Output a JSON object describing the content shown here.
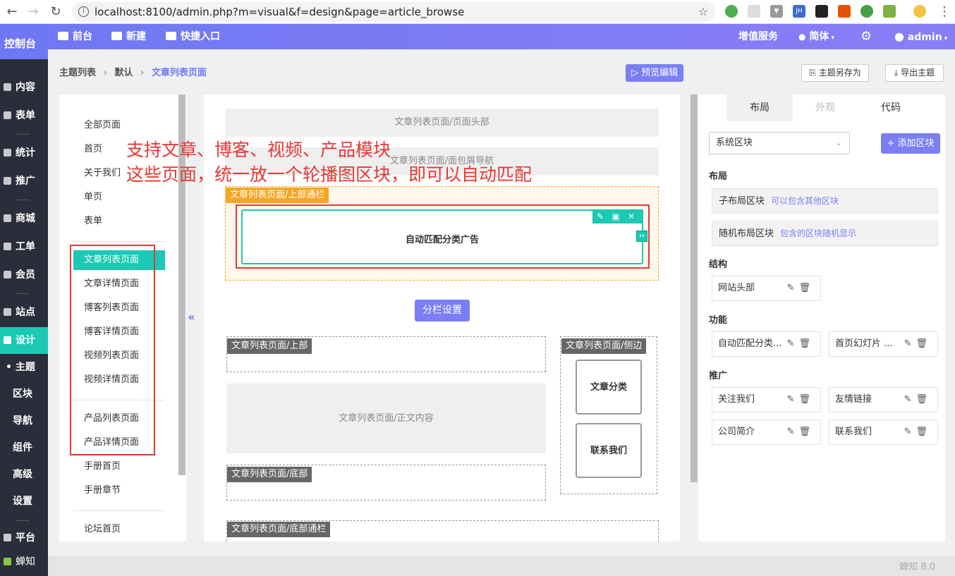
{
  "browser": {
    "url": "localhost:8100/admin.php?m=visual&f=design&page=article_browse",
    "back_icon": "arrow-left-icon",
    "extensions": [
      "globe",
      "ext",
      "vue",
      "JH",
      "cat",
      "share",
      "chrome",
      "rss",
      "avatar"
    ]
  },
  "topbar": {
    "brand": "控制台",
    "items": [
      "前台",
      "新建",
      "快捷入口"
    ],
    "right": {
      "value_added": "增值服务",
      "lang": "简体",
      "user": "admin"
    }
  },
  "sidebar": {
    "items": [
      {
        "label": "内容"
      },
      {
        "label": "表单"
      },
      {
        "label": "统计"
      },
      {
        "label": "推广"
      },
      {
        "label": "商城"
      },
      {
        "label": "工单"
      },
      {
        "label": "会员"
      },
      {
        "label": "站点"
      },
      {
        "label": "设计"
      }
    ],
    "sub": [
      "主题",
      "区块",
      "导航",
      "组件",
      "高级",
      "设置"
    ],
    "bottom": {
      "platform": "平台",
      "logo": "蝉知"
    }
  },
  "breadcrumb": {
    "a": "主题列表",
    "b": "默认",
    "current": "文章列表页面"
  },
  "toolbar": {
    "preview": "预览编辑",
    "save_as": "主题另存为",
    "export": "导出主题"
  },
  "pages": {
    "items": [
      "全部页面",
      "首页",
      "关于我们",
      "单页",
      "表单",
      "文章列表页面",
      "文章详情页面",
      "博客列表页面",
      "博客详情页面",
      "视频列表页面",
      "视频详情页面",
      "产品列表页面",
      "产品详情页面",
      "手册首页",
      "手册章节",
      "论坛首页"
    ]
  },
  "annotation": {
    "line1": "支持文章、博客、视频、产品模块",
    "line2": "这些页面，统一放一个轮播图区块，即可以自动匹配"
  },
  "canvas": {
    "header": "文章列表页面/页面头部",
    "nav": "文章列表页面/面包屑导航",
    "top_banner": "文章列表页面/上部通栏",
    "ad_block": "自动匹配分类广告",
    "column_settings": "分栏设置",
    "top": "文章列表页面/上部",
    "side": "文章列表页面/侧边",
    "main": "文章列表页面/正文内容",
    "bottom": "文章列表页面/底部",
    "bottom_banner": "文章列表页面/底部通栏",
    "side_blocks": [
      "文章分类",
      "联系我们"
    ]
  },
  "right_panel": {
    "tabs": [
      "布局",
      "外观",
      "代码"
    ],
    "select": "系统区块",
    "add": "添加区块",
    "sections": {
      "layout": "布局",
      "structure": "结构",
      "function": "功能",
      "promotion": "推广"
    },
    "layouts": [
      {
        "name": "子布局区块",
        "hint": "可以包含其他区块"
      },
      {
        "name": "随机布局区块",
        "hint": "包含的区块随机显示"
      }
    ],
    "structure": [
      "网站头部"
    ],
    "function": [
      "自动匹配分类...",
      "首页幻灯片 ..."
    ],
    "promotion": [
      "关注我们",
      "友情链接",
      "公司简介",
      "联系我们"
    ]
  },
  "footer": {
    "version": "蝉知 8.0"
  },
  "colors": {
    "accent": "#7a7ff5",
    "teal": "#1bc9b4",
    "orange": "#f5a623",
    "red": "#e53935"
  }
}
